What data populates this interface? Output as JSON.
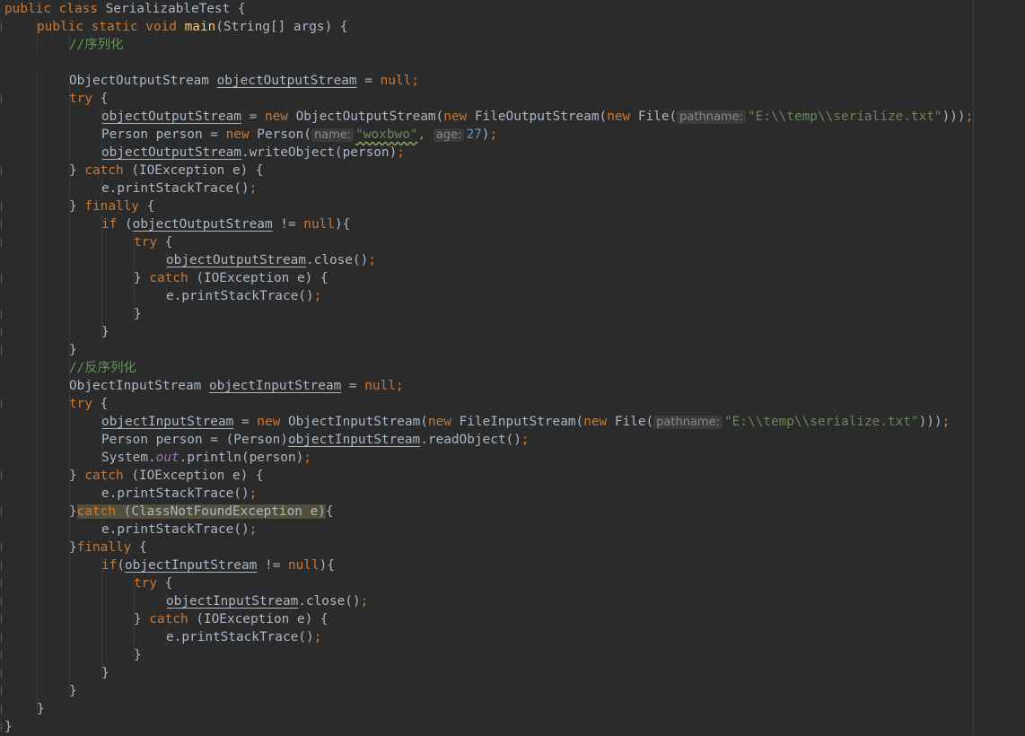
{
  "editor": {
    "language": "Java",
    "theme": "darcula",
    "colors": {
      "background": "#2b2b2b",
      "keyword": "#cc7832",
      "method_declaration": "#ffc66d",
      "string": "#6a8759",
      "number": "#6897bb",
      "comment": "#629755",
      "static_field": "#9876aa",
      "plain": "#a9b7c6",
      "param_hint": "#8a8a8a",
      "highlight": "#52503a"
    }
  },
  "lines": [
    {
      "indent": 0,
      "tokens": [
        {
          "t": "public class ",
          "c": "kw"
        },
        {
          "t": "SerializableTest {",
          "c": "pln"
        }
      ]
    },
    {
      "indent": 1,
      "tokens": [
        {
          "t": "public static void ",
          "c": "kw"
        },
        {
          "t": "main",
          "c": "fn"
        },
        {
          "t": "(String[] args) {",
          "c": "pln"
        }
      ]
    },
    {
      "indent": 2,
      "tokens": [
        {
          "t": "//序列化",
          "c": "cmt"
        }
      ]
    },
    {
      "indent": 0,
      "tokens": []
    },
    {
      "indent": 2,
      "tokens": [
        {
          "t": "ObjectOutputStream ",
          "c": "pln"
        },
        {
          "t": "objectOutputStream",
          "c": "var"
        },
        {
          "t": " = ",
          "c": "pln"
        },
        {
          "t": "null;",
          "c": "kw"
        }
      ]
    },
    {
      "indent": 2,
      "tokens": [
        {
          "t": "try ",
          "c": "kw"
        },
        {
          "t": "{",
          "c": "pln"
        }
      ]
    },
    {
      "indent": 3,
      "tokens": [
        {
          "t": "objectOutputStream",
          "c": "var"
        },
        {
          "t": " = ",
          "c": "pln"
        },
        {
          "t": "new ",
          "c": "kw"
        },
        {
          "t": "ObjectOutputStream(",
          "c": "pln"
        },
        {
          "t": "new ",
          "c": "kw"
        },
        {
          "t": "FileOutputStream(",
          "c": "pln"
        },
        {
          "t": "new ",
          "c": "kw"
        },
        {
          "t": "File(",
          "c": "pln"
        },
        {
          "t": "pathname:",
          "c": "hint"
        },
        {
          "t": "\"E:\\\\temp\\\\serialize.txt\"",
          "c": "str"
        },
        {
          "t": ")))",
          "c": "pln"
        },
        {
          "t": ";",
          "c": "kw"
        }
      ]
    },
    {
      "indent": 3,
      "tokens": [
        {
          "t": "Person person = ",
          "c": "pln"
        },
        {
          "t": "new ",
          "c": "kw"
        },
        {
          "t": "Person(",
          "c": "pln"
        },
        {
          "t": "name:",
          "c": "hint"
        },
        {
          "t": "\"woxbwo\"",
          "c": "str warn"
        },
        {
          "t": ", ",
          "c": "kw"
        },
        {
          "t": "age:",
          "c": "hint"
        },
        {
          "t": "27",
          "c": "num"
        },
        {
          "t": ")",
          "c": "pln"
        },
        {
          "t": ";",
          "c": "kw"
        }
      ]
    },
    {
      "indent": 3,
      "tokens": [
        {
          "t": "objectOutputStream",
          "c": "var"
        },
        {
          "t": ".writeObject(person)",
          "c": "pln"
        },
        {
          "t": ";",
          "c": "kw"
        }
      ]
    },
    {
      "indent": 2,
      "tokens": [
        {
          "t": "} ",
          "c": "pln"
        },
        {
          "t": "catch ",
          "c": "kw"
        },
        {
          "t": "(IOException e) {",
          "c": "pln"
        }
      ]
    },
    {
      "indent": 3,
      "tokens": [
        {
          "t": "e.printStackTrace()",
          "c": "pln"
        },
        {
          "t": ";",
          "c": "kw"
        }
      ]
    },
    {
      "indent": 2,
      "tokens": [
        {
          "t": "} ",
          "c": "pln"
        },
        {
          "t": "finally ",
          "c": "kw"
        },
        {
          "t": "{",
          "c": "pln"
        }
      ]
    },
    {
      "indent": 3,
      "tokens": [
        {
          "t": "if ",
          "c": "kw"
        },
        {
          "t": "(",
          "c": "pln"
        },
        {
          "t": "objectOutputStream",
          "c": "var"
        },
        {
          "t": " != ",
          "c": "pln"
        },
        {
          "t": "null",
          "c": "kw"
        },
        {
          "t": "){",
          "c": "pln"
        }
      ]
    },
    {
      "indent": 4,
      "tokens": [
        {
          "t": "try ",
          "c": "kw"
        },
        {
          "t": "{",
          "c": "pln"
        }
      ]
    },
    {
      "indent": 5,
      "tokens": [
        {
          "t": "objectOutputStream",
          "c": "var"
        },
        {
          "t": ".close()",
          "c": "pln"
        },
        {
          "t": ";",
          "c": "kw"
        }
      ]
    },
    {
      "indent": 4,
      "tokens": [
        {
          "t": "} ",
          "c": "pln"
        },
        {
          "t": "catch ",
          "c": "kw"
        },
        {
          "t": "(IOException e) {",
          "c": "pln"
        }
      ]
    },
    {
      "indent": 5,
      "tokens": [
        {
          "t": "e.printStackTrace()",
          "c": "pln"
        },
        {
          "t": ";",
          "c": "kw"
        }
      ]
    },
    {
      "indent": 4,
      "tokens": [
        {
          "t": "}",
          "c": "pln"
        }
      ]
    },
    {
      "indent": 3,
      "tokens": [
        {
          "t": "}",
          "c": "pln"
        }
      ]
    },
    {
      "indent": 2,
      "tokens": [
        {
          "t": "}",
          "c": "pln"
        }
      ]
    },
    {
      "indent": 2,
      "tokens": [
        {
          "t": "//反序列化",
          "c": "cmt"
        }
      ]
    },
    {
      "indent": 2,
      "tokens": [
        {
          "t": "ObjectInputStream ",
          "c": "pln"
        },
        {
          "t": "objectInputStream",
          "c": "var"
        },
        {
          "t": " = ",
          "c": "pln"
        },
        {
          "t": "null;",
          "c": "kw"
        }
      ]
    },
    {
      "indent": 2,
      "tokens": [
        {
          "t": "try ",
          "c": "kw"
        },
        {
          "t": "{",
          "c": "pln"
        }
      ]
    },
    {
      "indent": 3,
      "tokens": [
        {
          "t": "objectInputStream",
          "c": "var"
        },
        {
          "t": " = ",
          "c": "pln"
        },
        {
          "t": "new ",
          "c": "kw"
        },
        {
          "t": "ObjectInputStream(",
          "c": "pln"
        },
        {
          "t": "new ",
          "c": "kw"
        },
        {
          "t": "FileInputStream(",
          "c": "pln"
        },
        {
          "t": "new ",
          "c": "kw"
        },
        {
          "t": "File(",
          "c": "pln"
        },
        {
          "t": "pathname:",
          "c": "hint"
        },
        {
          "t": "\"E:\\\\temp\\\\serialize.txt\"",
          "c": "str"
        },
        {
          "t": ")))",
          "c": "pln"
        },
        {
          "t": ";",
          "c": "kw"
        }
      ]
    },
    {
      "indent": 3,
      "tokens": [
        {
          "t": "Person person = (Person)",
          "c": "pln"
        },
        {
          "t": "objectInputStream",
          "c": "var"
        },
        {
          "t": ".readObject()",
          "c": "pln"
        },
        {
          "t": ";",
          "c": "kw"
        }
      ]
    },
    {
      "indent": 3,
      "tokens": [
        {
          "t": "System.",
          "c": "pln"
        },
        {
          "t": "out",
          "c": "fld"
        },
        {
          "t": ".println(person)",
          "c": "pln"
        },
        {
          "t": ";",
          "c": "kw"
        }
      ]
    },
    {
      "indent": 2,
      "tokens": [
        {
          "t": "} ",
          "c": "pln"
        },
        {
          "t": "catch ",
          "c": "kw"
        },
        {
          "t": "(IOException e) {",
          "c": "pln"
        }
      ]
    },
    {
      "indent": 3,
      "tokens": [
        {
          "t": "e.printStackTrace()",
          "c": "pln"
        },
        {
          "t": ";",
          "c": "kw"
        }
      ]
    },
    {
      "indent": 2,
      "tokens": [
        {
          "t": "}",
          "c": "pln"
        },
        {
          "t": "catch ",
          "c": "kw hl"
        },
        {
          "t": "(ClassNotFoundException e)",
          "c": "pln hl"
        },
        {
          "t": "{",
          "c": "pln"
        }
      ]
    },
    {
      "indent": 3,
      "tokens": [
        {
          "t": "e.printStackTrace()",
          "c": "pln"
        },
        {
          "t": ";",
          "c": "kw"
        }
      ]
    },
    {
      "indent": 2,
      "tokens": [
        {
          "t": "}",
          "c": "pln"
        },
        {
          "t": "finally ",
          "c": "kw"
        },
        {
          "t": "{",
          "c": "pln"
        }
      ]
    },
    {
      "indent": 3,
      "tokens": [
        {
          "t": "if",
          "c": "kw"
        },
        {
          "t": "(",
          "c": "pln"
        },
        {
          "t": "objectInputStream",
          "c": "var"
        },
        {
          "t": " != ",
          "c": "pln"
        },
        {
          "t": "null",
          "c": "kw"
        },
        {
          "t": "){",
          "c": "pln"
        }
      ]
    },
    {
      "indent": 4,
      "tokens": [
        {
          "t": "try ",
          "c": "kw"
        },
        {
          "t": "{",
          "c": "pln"
        }
      ]
    },
    {
      "indent": 5,
      "tokens": [
        {
          "t": "objectInputStream",
          "c": "var"
        },
        {
          "t": ".close()",
          "c": "pln"
        },
        {
          "t": ";",
          "c": "kw"
        }
      ]
    },
    {
      "indent": 4,
      "tokens": [
        {
          "t": "} ",
          "c": "pln"
        },
        {
          "t": "catch ",
          "c": "kw"
        },
        {
          "t": "(IOException e) {",
          "c": "pln"
        }
      ]
    },
    {
      "indent": 5,
      "tokens": [
        {
          "t": "e.printStackTrace()",
          "c": "pln"
        },
        {
          "t": ";",
          "c": "kw"
        }
      ]
    },
    {
      "indent": 4,
      "tokens": [
        {
          "t": "}",
          "c": "pln"
        }
      ]
    },
    {
      "indent": 3,
      "tokens": [
        {
          "t": "}",
          "c": "pln"
        }
      ]
    },
    {
      "indent": 2,
      "tokens": [
        {
          "t": "}",
          "c": "pln"
        }
      ]
    },
    {
      "indent": 1,
      "tokens": [
        {
          "t": "}",
          "c": "pln"
        }
      ]
    },
    {
      "indent": 0,
      "tokens": [
        {
          "t": "}",
          "c": "pln"
        }
      ]
    }
  ]
}
